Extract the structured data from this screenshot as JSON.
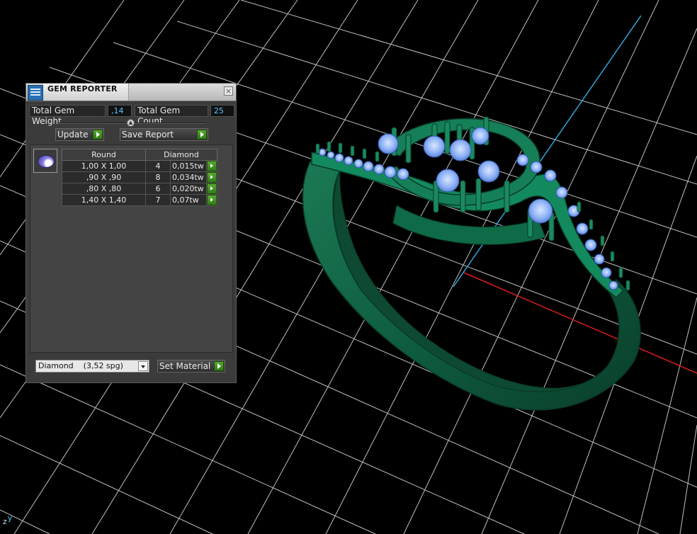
{
  "panel": {
    "title": "GEM REPORTER",
    "close_glyph": "×",
    "total_gem_weight_label": "Total Gem Weight",
    "total_gem_weight_value": ",14",
    "total_gem_count_label": "Total Gem Count",
    "total_gem_count_value": "25",
    "update_label": "Update",
    "save_report_label": "Save Report",
    "gem_table": {
      "shape_header": "Round",
      "material_header": "Diamond",
      "rows": [
        {
          "size": "1,00 X 1,00",
          "count": "4",
          "weight": "0,015tw"
        },
        {
          "size": ",90 X ,90",
          "count": "8",
          "weight": "0,034tw"
        },
        {
          "size": ",80 X ,80",
          "count": "6",
          "weight": "0,020tw"
        },
        {
          "size": "1,40 X 1,40",
          "count": "7",
          "weight": "0,07tw"
        }
      ]
    },
    "material_select_value": "Diamond    (3,52 spg)",
    "set_material_label": "Set Material"
  },
  "axis": {
    "z": "z",
    "y": "y"
  },
  "colors": {
    "viewport_bg": "#000000",
    "grid": "#d6d6d6",
    "ring_green": "#0f5f40",
    "gem_blue": "#8cb0f5",
    "axis_red": "#d51c1c",
    "axis_cyan": "#2fa6d8"
  }
}
